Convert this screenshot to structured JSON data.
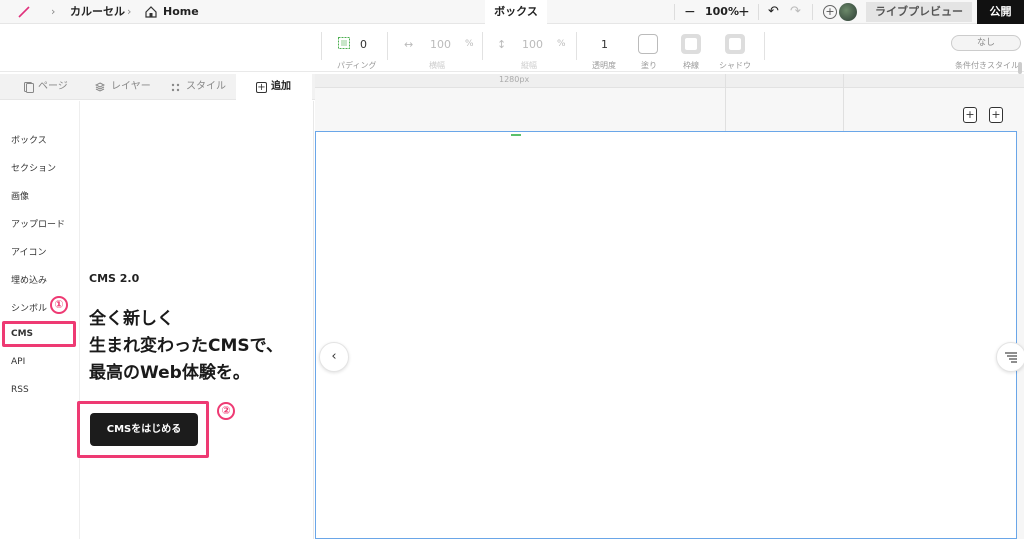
{
  "topbar": {
    "breadcrumb": [
      "カルーセル",
      "Home"
    ],
    "active_tab": "ボックス",
    "zoom": "100%",
    "preview": "ライブプレビュー",
    "publish": "公開"
  },
  "propbar": {
    "padding_value": "0",
    "padding_label": "パディング",
    "width_value": "100",
    "width_unit": "%",
    "width_label": "横幅",
    "height_value": "100",
    "height_unit": "%",
    "height_label": "縦幅",
    "opacity_value": "1",
    "opacity_label": "透明度",
    "fill_label": "塗り",
    "border_label": "枠線",
    "shadow_label": "シャドウ",
    "condition_value": "なし",
    "condition_label": "条件付きスタイル"
  },
  "panel": {
    "tabs": [
      "ページ",
      "レイヤー",
      "スタイル",
      "追加"
    ],
    "side_items": [
      "ボックス",
      "セクション",
      "画像",
      "アップロード",
      "アイコン",
      "埋め込み",
      "シンボル",
      "CMS",
      "API",
      "RSS"
    ],
    "cms_version": "CMS 2.0",
    "headline": [
      "全く新しく",
      "生まれ変わったCMSで、",
      "最高のWeb体験を。"
    ],
    "start_button": "CMSをはじめる",
    "marker_1": "①",
    "marker_2": "②"
  },
  "canvas": {
    "ruler_label": "1280px"
  },
  "colors": {
    "highlight": "#ee3a73",
    "selection": "#6aa6e8",
    "publish_bg": "#111111"
  }
}
